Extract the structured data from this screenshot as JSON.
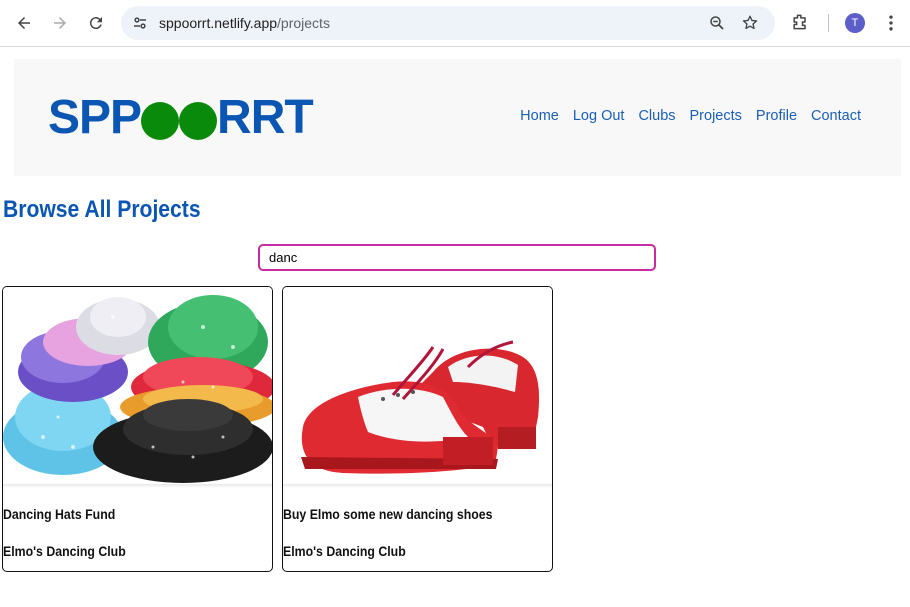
{
  "browser": {
    "url_host": "sppoorrt.netlify.app",
    "url_path": "/projects",
    "avatar_initial": "T"
  },
  "site": {
    "logo_left": "SPP",
    "logo_right": "RRT",
    "nav": [
      "Home",
      "Log Out",
      "Clubs",
      "Projects",
      "Profile",
      "Contact"
    ]
  },
  "page": {
    "title": "Browse All Projects",
    "search_value": "danc"
  },
  "projects": [
    {
      "title": "Dancing Hats Fund",
      "club": "Elmo's Dancing Club",
      "image": "sequin-hats"
    },
    {
      "title": "Buy Elmo some new dancing shoes",
      "club": "Elmo's Dancing Club",
      "image": "tap-shoes"
    }
  ],
  "colors": {
    "brand_blue": "#0b56b2",
    "brand_green": "#0a8a0a",
    "search_border": "#c72ba3"
  }
}
